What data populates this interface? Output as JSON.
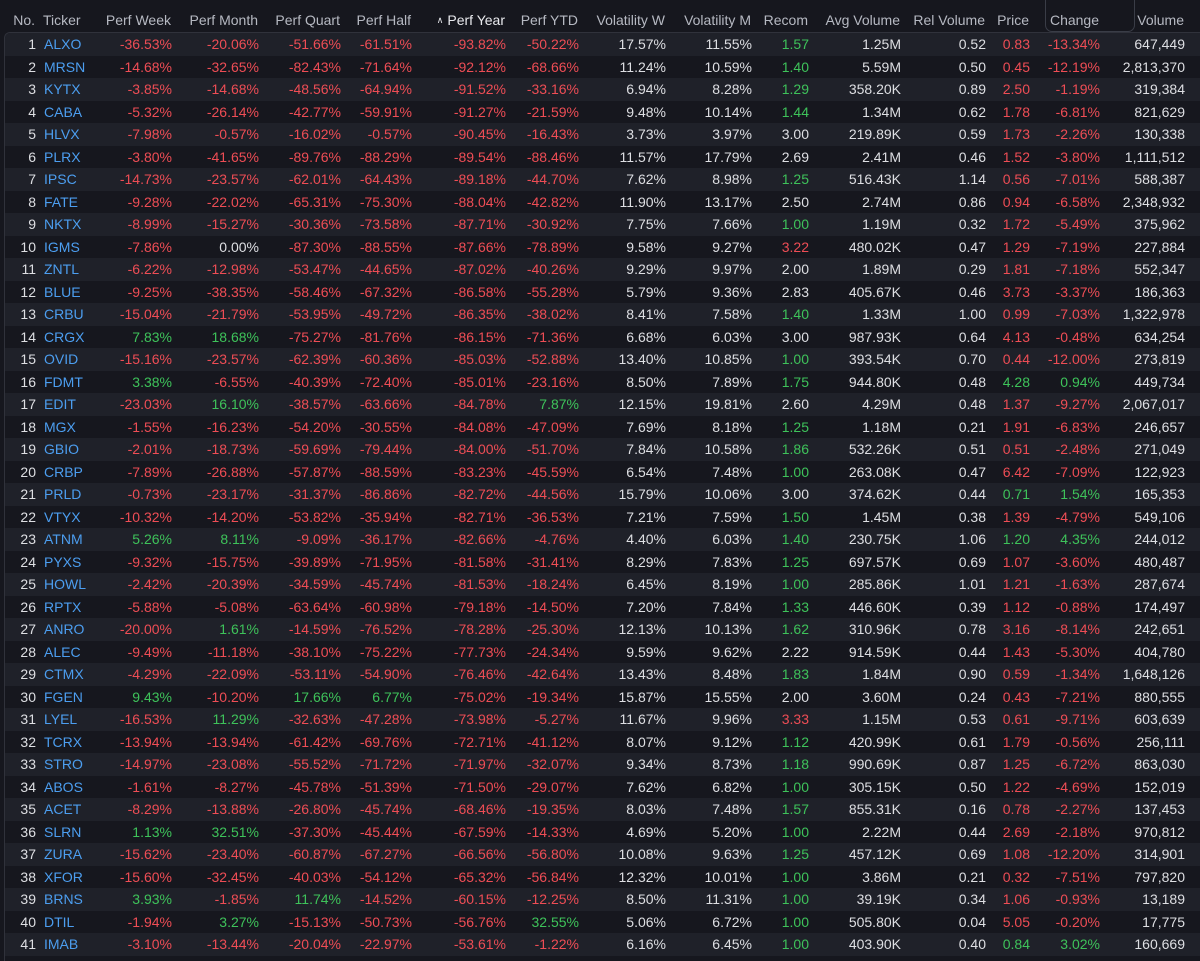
{
  "table": {
    "sort_indicator": "^",
    "columns": [
      {
        "key": "no",
        "label": "No."
      },
      {
        "key": "ticker",
        "label": "Ticker"
      },
      {
        "key": "perf_week",
        "label": "Perf Week"
      },
      {
        "key": "perf_month",
        "label": "Perf Month"
      },
      {
        "key": "perf_quart",
        "label": "Perf Quart"
      },
      {
        "key": "perf_half",
        "label": "Perf Half"
      },
      {
        "key": "perf_year",
        "label": "Perf Year",
        "sorted": true
      },
      {
        "key": "perf_ytd",
        "label": "Perf YTD"
      },
      {
        "key": "vol_w",
        "label": "Volatility W"
      },
      {
        "key": "vol_m",
        "label": "Volatility M"
      },
      {
        "key": "recom",
        "label": "Recom"
      },
      {
        "key": "avg_vol",
        "label": "Avg Volume"
      },
      {
        "key": "rel_vol",
        "label": "Rel Volume"
      },
      {
        "key": "price",
        "label": "Price"
      },
      {
        "key": "change",
        "label": "Change"
      },
      {
        "key": "volume",
        "label": "Volume"
      }
    ],
    "colors": {
      "positive": "#3ec25a",
      "negative": "#ee4d55",
      "ticker": "#4c9ef0",
      "neutral": "#dedfe3"
    },
    "rows": [
      [
        "1",
        "ALXO",
        "-36.53%",
        "-20.06%",
        "-51.66%",
        "-61.51%",
        "-93.82%",
        "-50.22%",
        "17.57%",
        "11.55%",
        "1.57",
        "1.25M",
        "0.52",
        "0.83",
        "-13.34%",
        "647,449"
      ],
      [
        "2",
        "MRSN",
        "-14.68%",
        "-32.65%",
        "-82.43%",
        "-71.64%",
        "-92.12%",
        "-68.66%",
        "11.24%",
        "10.59%",
        "1.40",
        "5.59M",
        "0.50",
        "0.45",
        "-12.19%",
        "2,813,370"
      ],
      [
        "3",
        "KYTX",
        "-3.85%",
        "-14.68%",
        "-48.56%",
        "-64.94%",
        "-91.52%",
        "-33.16%",
        "6.94%",
        "8.28%",
        "1.29",
        "358.20K",
        "0.89",
        "2.50",
        "-1.19%",
        "319,384"
      ],
      [
        "4",
        "CABA",
        "-5.32%",
        "-26.14%",
        "-42.77%",
        "-59.91%",
        "-91.27%",
        "-21.59%",
        "9.48%",
        "10.14%",
        "1.44",
        "1.34M",
        "0.62",
        "1.78",
        "-6.81%",
        "821,629"
      ],
      [
        "5",
        "HLVX",
        "-7.98%",
        "-0.57%",
        "-16.02%",
        "-0.57%",
        "-90.45%",
        "-16.43%",
        "3.73%",
        "3.97%",
        "3.00",
        "219.89K",
        "0.59",
        "1.73",
        "-2.26%",
        "130,338"
      ],
      [
        "6",
        "PLRX",
        "-3.80%",
        "-41.65%",
        "-89.76%",
        "-88.29%",
        "-89.54%",
        "-88.46%",
        "11.57%",
        "17.79%",
        "2.69",
        "2.41M",
        "0.46",
        "1.52",
        "-3.80%",
        "1,111,512"
      ],
      [
        "7",
        "IPSC",
        "-14.73%",
        "-23.57%",
        "-62.01%",
        "-64.43%",
        "-89.18%",
        "-44.70%",
        "7.62%",
        "8.98%",
        "1.25",
        "516.43K",
        "1.14",
        "0.56",
        "-7.01%",
        "588,387"
      ],
      [
        "8",
        "FATE",
        "-9.28%",
        "-22.02%",
        "-65.31%",
        "-75.30%",
        "-88.04%",
        "-42.82%",
        "11.90%",
        "13.17%",
        "2.50",
        "2.74M",
        "0.86",
        "0.94",
        "-6.58%",
        "2,348,932"
      ],
      [
        "9",
        "NKTX",
        "-8.99%",
        "-15.27%",
        "-30.36%",
        "-73.58%",
        "-87.71%",
        "-30.92%",
        "7.75%",
        "7.66%",
        "1.00",
        "1.19M",
        "0.32",
        "1.72",
        "-5.49%",
        "375,962"
      ],
      [
        "10",
        "IGMS",
        "-7.86%",
        "0.00%",
        "-87.30%",
        "-88.55%",
        "-87.66%",
        "-78.89%",
        "9.58%",
        "9.27%",
        "3.22",
        "480.02K",
        "0.47",
        "1.29",
        "-7.19%",
        "227,884"
      ],
      [
        "11",
        "ZNTL",
        "-6.22%",
        "-12.98%",
        "-53.47%",
        "-44.65%",
        "-87.02%",
        "-40.26%",
        "9.29%",
        "9.97%",
        "2.00",
        "1.89M",
        "0.29",
        "1.81",
        "-7.18%",
        "552,347"
      ],
      [
        "12",
        "BLUE",
        "-9.25%",
        "-38.35%",
        "-58.46%",
        "-67.32%",
        "-86.58%",
        "-55.28%",
        "5.79%",
        "9.36%",
        "2.83",
        "405.67K",
        "0.46",
        "3.73",
        "-3.37%",
        "186,363"
      ],
      [
        "13",
        "CRBU",
        "-15.04%",
        "-21.79%",
        "-53.95%",
        "-49.72%",
        "-86.35%",
        "-38.02%",
        "8.41%",
        "7.58%",
        "1.40",
        "1.33M",
        "1.00",
        "0.99",
        "-7.03%",
        "1,322,978"
      ],
      [
        "14",
        "CRGX",
        "7.83%",
        "18.68%",
        "-75.27%",
        "-81.76%",
        "-86.15%",
        "-71.36%",
        "6.68%",
        "6.03%",
        "3.00",
        "987.93K",
        "0.64",
        "4.13",
        "-0.48%",
        "634,254"
      ],
      [
        "15",
        "OVID",
        "-15.16%",
        "-23.57%",
        "-62.39%",
        "-60.36%",
        "-85.03%",
        "-52.88%",
        "13.40%",
        "10.85%",
        "1.00",
        "393.54K",
        "0.70",
        "0.44",
        "-12.00%",
        "273,819"
      ],
      [
        "16",
        "FDMT",
        "3.38%",
        "-6.55%",
        "-40.39%",
        "-72.40%",
        "-85.01%",
        "-23.16%",
        "8.50%",
        "7.89%",
        "1.75",
        "944.80K",
        "0.48",
        "4.28",
        "0.94%",
        "449,734"
      ],
      [
        "17",
        "EDIT",
        "-23.03%",
        "16.10%",
        "-38.57%",
        "-63.66%",
        "-84.78%",
        "7.87%",
        "12.15%",
        "19.81%",
        "2.60",
        "4.29M",
        "0.48",
        "1.37",
        "-9.27%",
        "2,067,017"
      ],
      [
        "18",
        "MGX",
        "-1.55%",
        "-16.23%",
        "-54.20%",
        "-30.55%",
        "-84.08%",
        "-47.09%",
        "7.69%",
        "8.18%",
        "1.25",
        "1.18M",
        "0.21",
        "1.91",
        "-6.83%",
        "246,657"
      ],
      [
        "19",
        "GBIO",
        "-2.01%",
        "-18.73%",
        "-59.69%",
        "-79.44%",
        "-84.00%",
        "-51.70%",
        "7.84%",
        "10.58%",
        "1.86",
        "532.26K",
        "0.51",
        "0.51",
        "-2.48%",
        "271,049"
      ],
      [
        "20",
        "CRBP",
        "-7.89%",
        "-26.88%",
        "-57.87%",
        "-88.59%",
        "-83.23%",
        "-45.59%",
        "6.54%",
        "7.48%",
        "1.00",
        "263.08K",
        "0.47",
        "6.42",
        "-7.09%",
        "122,923"
      ],
      [
        "21",
        "PRLD",
        "-0.73%",
        "-23.17%",
        "-31.37%",
        "-86.86%",
        "-82.72%",
        "-44.56%",
        "15.79%",
        "10.06%",
        "3.00",
        "374.62K",
        "0.44",
        "0.71",
        "1.54%",
        "165,353"
      ],
      [
        "22",
        "VTYX",
        "-10.32%",
        "-14.20%",
        "-53.82%",
        "-35.94%",
        "-82.71%",
        "-36.53%",
        "7.21%",
        "7.59%",
        "1.50",
        "1.45M",
        "0.38",
        "1.39",
        "-4.79%",
        "549,106"
      ],
      [
        "23",
        "ATNM",
        "5.26%",
        "8.11%",
        "-9.09%",
        "-36.17%",
        "-82.66%",
        "-4.76%",
        "4.40%",
        "6.03%",
        "1.40",
        "230.75K",
        "1.06",
        "1.20",
        "4.35%",
        "244,012"
      ],
      [
        "24",
        "PYXS",
        "-9.32%",
        "-15.75%",
        "-39.89%",
        "-71.95%",
        "-81.58%",
        "-31.41%",
        "8.29%",
        "7.83%",
        "1.25",
        "697.57K",
        "0.69",
        "1.07",
        "-3.60%",
        "480,487"
      ],
      [
        "25",
        "HOWL",
        "-2.42%",
        "-20.39%",
        "-34.59%",
        "-45.74%",
        "-81.53%",
        "-18.24%",
        "6.45%",
        "8.19%",
        "1.00",
        "285.86K",
        "1.01",
        "1.21",
        "-1.63%",
        "287,674"
      ],
      [
        "26",
        "RPTX",
        "-5.88%",
        "-5.08%",
        "-63.64%",
        "-60.98%",
        "-79.18%",
        "-14.50%",
        "7.20%",
        "7.84%",
        "1.33",
        "446.60K",
        "0.39",
        "1.12",
        "-0.88%",
        "174,497"
      ],
      [
        "27",
        "ANRO",
        "-20.00%",
        "1.61%",
        "-14.59%",
        "-76.52%",
        "-78.28%",
        "-25.30%",
        "12.13%",
        "10.13%",
        "1.62",
        "310.96K",
        "0.78",
        "3.16",
        "-8.14%",
        "242,651"
      ],
      [
        "28",
        "ALEC",
        "-9.49%",
        "-11.18%",
        "-38.10%",
        "-75.22%",
        "-77.73%",
        "-24.34%",
        "9.59%",
        "9.62%",
        "2.22",
        "914.59K",
        "0.44",
        "1.43",
        "-5.30%",
        "404,780"
      ],
      [
        "29",
        "CTMX",
        "-4.29%",
        "-22.09%",
        "-53.11%",
        "-54.90%",
        "-76.46%",
        "-42.64%",
        "13.43%",
        "8.48%",
        "1.83",
        "1.84M",
        "0.90",
        "0.59",
        "-1.34%",
        "1,648,126"
      ],
      [
        "30",
        "FGEN",
        "9.43%",
        "-10.20%",
        "17.66%",
        "6.77%",
        "-75.02%",
        "-19.34%",
        "15.87%",
        "15.55%",
        "2.00",
        "3.60M",
        "0.24",
        "0.43",
        "-7.21%",
        "880,555"
      ],
      [
        "31",
        "LYEL",
        "-16.53%",
        "11.29%",
        "-32.63%",
        "-47.28%",
        "-73.98%",
        "-5.27%",
        "11.67%",
        "9.96%",
        "3.33",
        "1.15M",
        "0.53",
        "0.61",
        "-9.71%",
        "603,639"
      ],
      [
        "32",
        "TCRX",
        "-13.94%",
        "-13.94%",
        "-61.42%",
        "-69.76%",
        "-72.71%",
        "-41.12%",
        "8.07%",
        "9.12%",
        "1.12",
        "420.99K",
        "0.61",
        "1.79",
        "-0.56%",
        "256,111"
      ],
      [
        "33",
        "STRO",
        "-14.97%",
        "-23.08%",
        "-55.52%",
        "-71.72%",
        "-71.97%",
        "-32.07%",
        "9.34%",
        "8.73%",
        "1.18",
        "990.69K",
        "0.87",
        "1.25",
        "-6.72%",
        "863,030"
      ],
      [
        "34",
        "ABOS",
        "-1.61%",
        "-8.27%",
        "-45.78%",
        "-51.39%",
        "-71.50%",
        "-29.07%",
        "7.62%",
        "6.82%",
        "1.00",
        "305.15K",
        "0.50",
        "1.22",
        "-4.69%",
        "152,019"
      ],
      [
        "35",
        "ACET",
        "-8.29%",
        "-13.88%",
        "-26.80%",
        "-45.74%",
        "-68.46%",
        "-19.35%",
        "8.03%",
        "7.48%",
        "1.57",
        "855.31K",
        "0.16",
        "0.78",
        "-2.27%",
        "137,453"
      ],
      [
        "36",
        "SLRN",
        "1.13%",
        "32.51%",
        "-37.30%",
        "-45.44%",
        "-67.59%",
        "-14.33%",
        "4.69%",
        "5.20%",
        "1.00",
        "2.22M",
        "0.44",
        "2.69",
        "-2.18%",
        "970,812"
      ],
      [
        "37",
        "ZURA",
        "-15.62%",
        "-23.40%",
        "-60.87%",
        "-67.27%",
        "-66.56%",
        "-56.80%",
        "10.08%",
        "9.63%",
        "1.25",
        "457.12K",
        "0.69",
        "1.08",
        "-12.20%",
        "314,901"
      ],
      [
        "38",
        "XFOR",
        "-15.60%",
        "-32.45%",
        "-40.03%",
        "-54.12%",
        "-65.32%",
        "-56.84%",
        "12.32%",
        "10.01%",
        "1.00",
        "3.86M",
        "0.21",
        "0.32",
        "-7.51%",
        "797,820"
      ],
      [
        "39",
        "BRNS",
        "3.93%",
        "-1.85%",
        "11.74%",
        "-14.52%",
        "-60.15%",
        "-12.25%",
        "8.50%",
        "11.31%",
        "1.00",
        "39.19K",
        "0.34",
        "1.06",
        "-0.93%",
        "13,189"
      ],
      [
        "40",
        "DTIL",
        "-1.94%",
        "3.27%",
        "-15.13%",
        "-50.73%",
        "-56.76%",
        "32.55%",
        "5.06%",
        "6.72%",
        "1.00",
        "505.80K",
        "0.04",
        "5.05",
        "-0.20%",
        "17,775"
      ],
      [
        "41",
        "IMAB",
        "-3.10%",
        "-13.44%",
        "-20.04%",
        "-22.97%",
        "-53.61%",
        "-1.22%",
        "6.16%",
        "6.45%",
        "1.00",
        "403.90K",
        "0.40",
        "0.84",
        "3.02%",
        "160,669"
      ]
    ]
  }
}
